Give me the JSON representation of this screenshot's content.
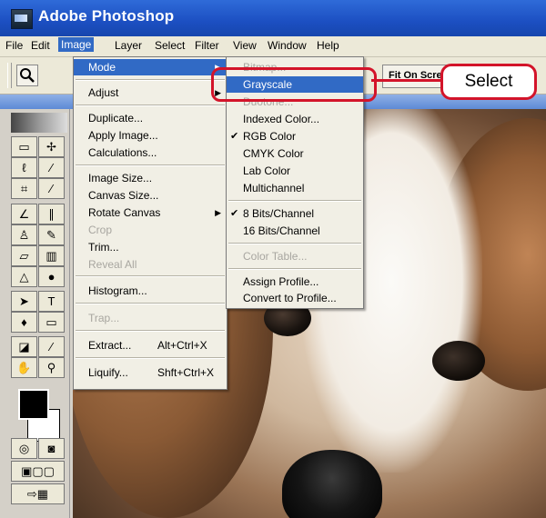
{
  "window": {
    "title": "Adobe Photoshop"
  },
  "menubar": {
    "items": [
      "File",
      "Edit",
      "Image",
      "Layer",
      "Select",
      "Filter",
      "View",
      "Window",
      "Help"
    ],
    "active": "Image"
  },
  "options_bar": {
    "fit_on_screen_label": "Fit On Scre"
  },
  "image_menu": {
    "items": [
      {
        "label": "Mode",
        "shortcut": "",
        "disabled": false,
        "submenu": true,
        "highlighted": true
      },
      {
        "label": "Adjust",
        "shortcut": "",
        "disabled": false,
        "submenu": true
      },
      {
        "label": "Duplicate...",
        "shortcut": "",
        "disabled": false
      },
      {
        "label": "Apply Image...",
        "shortcut": "",
        "disabled": false
      },
      {
        "label": "Calculations...",
        "shortcut": "",
        "disabled": false
      },
      {
        "label": "Image Size...",
        "shortcut": "",
        "disabled": false
      },
      {
        "label": "Canvas Size...",
        "shortcut": "",
        "disabled": false
      },
      {
        "label": "Rotate Canvas",
        "shortcut": "",
        "disabled": false,
        "submenu": true
      },
      {
        "label": "Crop",
        "shortcut": "",
        "disabled": true
      },
      {
        "label": "Trim...",
        "shortcut": "",
        "disabled": false
      },
      {
        "label": "Reveal All",
        "shortcut": "",
        "disabled": true
      },
      {
        "label": "Histogram...",
        "shortcut": "",
        "disabled": false
      },
      {
        "label": "Trap...",
        "shortcut": "",
        "disabled": true
      },
      {
        "label": "Extract...",
        "shortcut": "Alt+Ctrl+X",
        "disabled": false
      },
      {
        "label": "Liquify...",
        "shortcut": "Shft+Ctrl+X",
        "disabled": false
      }
    ]
  },
  "mode_submenu": {
    "items": [
      {
        "label": "Bitmap...",
        "disabled": true,
        "checked": false
      },
      {
        "label": "Grayscale",
        "disabled": false,
        "checked": false,
        "highlighted": true
      },
      {
        "label": "Duotone...",
        "disabled": true,
        "checked": false
      },
      {
        "label": "Indexed Color...",
        "disabled": false,
        "checked": false
      },
      {
        "label": "RGB Color",
        "disabled": false,
        "checked": true
      },
      {
        "label": "CMYK Color",
        "disabled": false,
        "checked": false
      },
      {
        "label": "Lab Color",
        "disabled": false,
        "checked": false
      },
      {
        "label": "Multichannel",
        "disabled": false,
        "checked": false
      },
      {
        "label": "8 Bits/Channel",
        "disabled": false,
        "checked": true
      },
      {
        "label": "16 Bits/Channel",
        "disabled": false,
        "checked": false
      },
      {
        "label": "Color Table...",
        "disabled": true,
        "checked": false
      },
      {
        "label": "Assign Profile...",
        "disabled": false,
        "checked": false
      },
      {
        "label": "Convert to Profile...",
        "disabled": false,
        "checked": false
      }
    ]
  },
  "callout": {
    "label": "Select",
    "color": "#d3142a"
  },
  "colors": {
    "title_bar": "#1c4fc2",
    "highlight": "#316ac5",
    "menu_bg": "#f1efe5"
  }
}
